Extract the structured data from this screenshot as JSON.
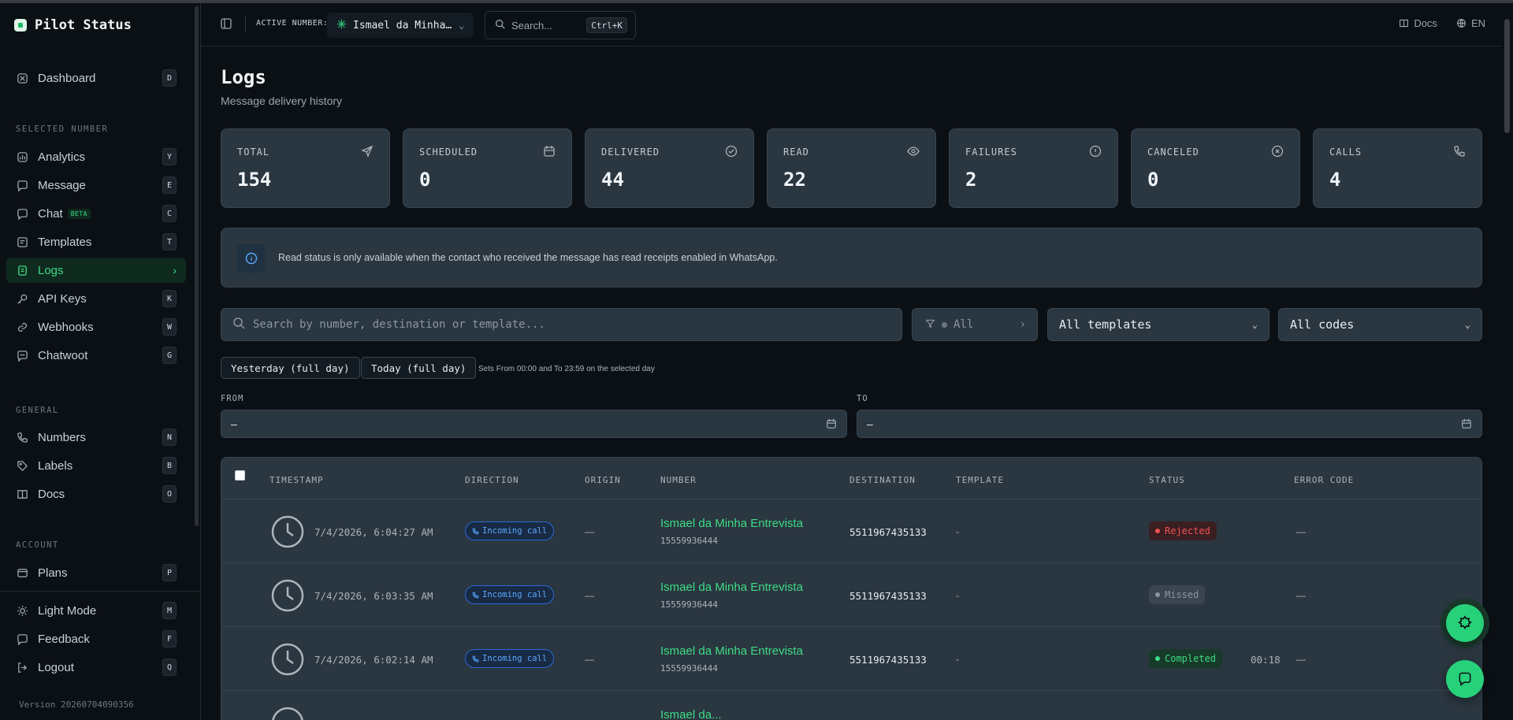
{
  "app": {
    "name": "Pilot Status",
    "version": "Version 20260704090356"
  },
  "sidebar": {
    "top_items": [
      {
        "label": "Dashboard",
        "key": "D",
        "icon": "dashboard-icon"
      }
    ],
    "sections": [
      {
        "title": "SELECTED NUMBER",
        "items": [
          {
            "label": "Analytics",
            "key": "Y"
          },
          {
            "label": "Message",
            "key": "E"
          },
          {
            "label": "Chat",
            "key": "C",
            "badge": "BETA"
          },
          {
            "label": "Templates",
            "key": "T"
          },
          {
            "label": "Logs",
            "key": "",
            "active": true
          },
          {
            "label": "API Keys",
            "key": "K"
          },
          {
            "label": "Webhooks",
            "key": "W"
          },
          {
            "label": "Chatwoot",
            "key": "G"
          }
        ]
      },
      {
        "title": "GENERAL",
        "items": [
          {
            "label": "Numbers",
            "key": "N"
          },
          {
            "label": "Labels",
            "key": "B"
          },
          {
            "label": "Docs",
            "key": "O"
          }
        ]
      },
      {
        "title": "ACCOUNT",
        "items": [
          {
            "label": "Plans",
            "key": "P"
          }
        ]
      }
    ],
    "bottom_items": [
      {
        "label": "Light Mode",
        "key": "M"
      },
      {
        "label": "Feedback",
        "key": "F"
      },
      {
        "label": "Logout",
        "key": "Q"
      }
    ]
  },
  "header": {
    "active_number_label": "ACTIVE NUMBER:",
    "active_number_value": "Ismael da Minha…",
    "search_placeholder": "Search...",
    "search_shortcut": "Ctrl+K",
    "docs_label": "Docs",
    "lang_label": "EN"
  },
  "page": {
    "title": "Logs",
    "subtitle": "Message delivery history"
  },
  "stats": [
    {
      "label": "TOTAL",
      "value": "154",
      "icon": "send-icon"
    },
    {
      "label": "SCHEDULED",
      "value": "0",
      "icon": "calendar-icon"
    },
    {
      "label": "DELIVERED",
      "value": "44",
      "icon": "check-circle-icon"
    },
    {
      "label": "READ",
      "value": "22",
      "icon": "eye-icon"
    },
    {
      "label": "FAILURES",
      "value": "2",
      "icon": "alert-circle-icon"
    },
    {
      "label": "CANCELED",
      "value": "0",
      "icon": "x-circle-icon"
    },
    {
      "label": "CALLS",
      "value": "4",
      "icon": "phone-icon"
    }
  ],
  "info_text": "Read status is only available when the contact who received the message has read receipts enabled in WhatsApp.",
  "filters": {
    "search_placeholder": "Search by number, destination or template...",
    "status_value": "All",
    "template_value": "All templates",
    "code_value": "All codes",
    "yesterday_label": "Yesterday (full day)",
    "today_label": "Today (full day)",
    "sets_note": "Sets From 00:00 and To 23:59 on the selected day",
    "from_label": "FROM",
    "to_label": "TO",
    "from_value": "–",
    "to_value": "–"
  },
  "table": {
    "columns": [
      "TIMESTAMP",
      "DIRECTION",
      "ORIGIN",
      "NUMBER",
      "DESTINATION",
      "TEMPLATE",
      "STATUS",
      "ERROR CODE"
    ],
    "rows": [
      {
        "timestamp": "7/4/2026, 6:04:27 AM",
        "direction": "Incoming call",
        "origin": "—",
        "name": "Ismael da Minha Entrevista",
        "number": "15559936444",
        "destination": "5511967435133",
        "template": "-",
        "status": "Rejected",
        "status_type": "rejected",
        "duration": "",
        "error": "—"
      },
      {
        "timestamp": "7/4/2026, 6:03:35 AM",
        "direction": "Incoming call",
        "origin": "—",
        "name": "Ismael da Minha Entrevista",
        "number": "15559936444",
        "destination": "5511967435133",
        "template": "-",
        "status": "Missed",
        "status_type": "missed",
        "duration": "",
        "error": "—"
      },
      {
        "timestamp": "7/4/2026, 6:02:14 AM",
        "direction": "Incoming call",
        "origin": "—",
        "name": "Ismael da Minha Entrevista",
        "number": "15559936444",
        "destination": "5511967435133",
        "template": "-",
        "status": "Completed",
        "status_type": "completed",
        "duration": "00:18",
        "error": "—"
      },
      {
        "timestamp": "",
        "direction": "",
        "origin": "",
        "name": "Ismael da...",
        "number": "",
        "destination": "",
        "template": "",
        "status": "",
        "status_type": "",
        "duration": "",
        "error": ""
      }
    ]
  },
  "colors": {
    "accent": "#3ddc84",
    "background": "#0b1015",
    "card": "#2a3640",
    "info_blue": "#5aa9ff",
    "danger": "#f05252"
  }
}
